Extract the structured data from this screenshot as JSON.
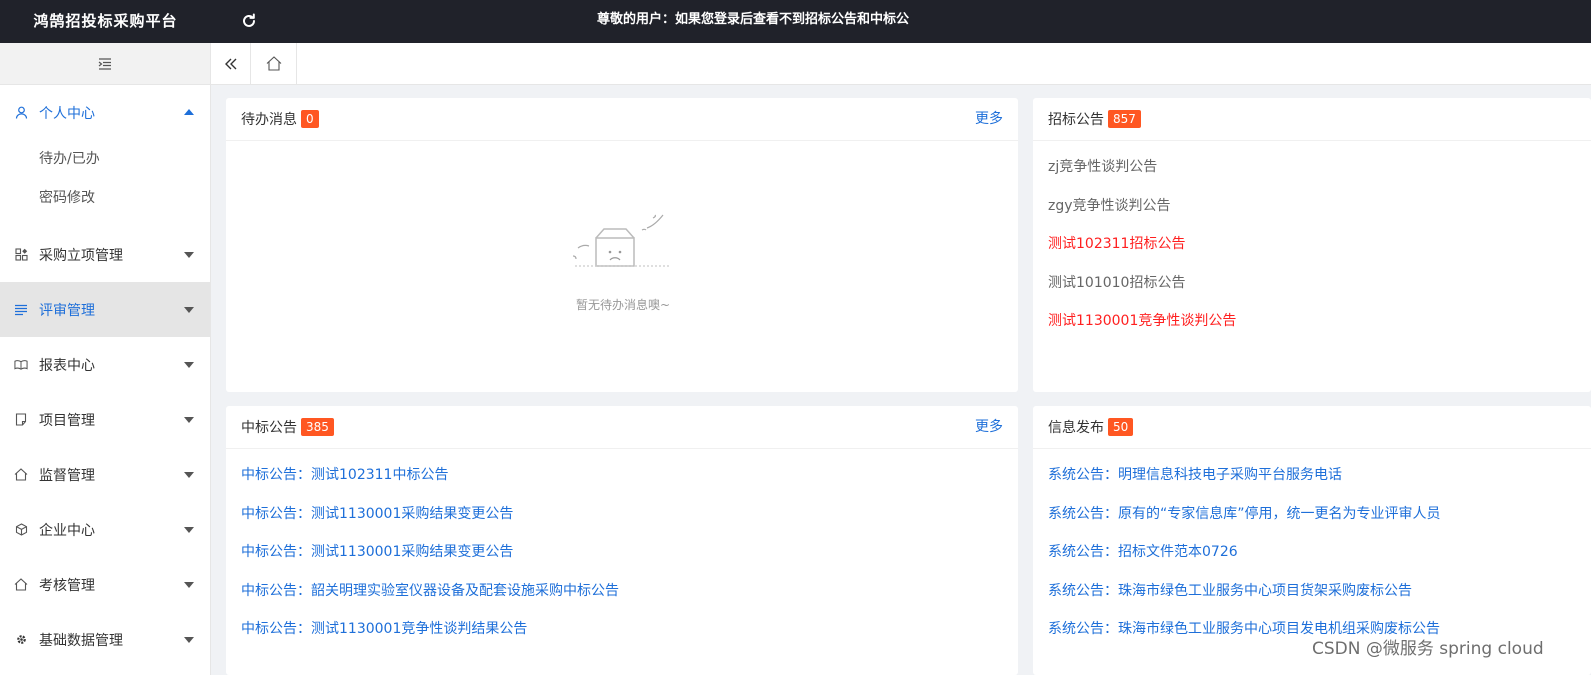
{
  "app": {
    "title": "鸿鹄招投标采购平台",
    "notice": "尊敬的用户：如果您登录后查看不到招标公告和中标公"
  },
  "sidebar": {
    "items": [
      {
        "label": "个人中心",
        "icon": "user-icon",
        "open": true,
        "sub": [
          "待办/已办",
          "密码修改"
        ]
      },
      {
        "label": "采购立项管理",
        "icon": "grid-icon"
      },
      {
        "label": "评审管理",
        "icon": "list-icon",
        "active": true
      },
      {
        "label": "报表中心",
        "icon": "book-icon"
      },
      {
        "label": "项目管理",
        "icon": "note-icon"
      },
      {
        "label": "监督管理",
        "icon": "home-icon"
      },
      {
        "label": "企业中心",
        "icon": "cube-icon"
      },
      {
        "label": "考核管理",
        "icon": "home-icon"
      },
      {
        "label": "基础数据管理",
        "icon": "gear-icon"
      }
    ]
  },
  "todo": {
    "title": "待办消息",
    "count": "0",
    "more": "更多",
    "empty_text": "暂无待办消息噢~"
  },
  "tender": {
    "title": "招标公告",
    "count": "857",
    "items": [
      {
        "text": "zj竞争性谈判公告",
        "color": "gray"
      },
      {
        "text": "zgy竞争性谈判公告",
        "color": "gray"
      },
      {
        "text": "测试102311招标公告",
        "color": "red"
      },
      {
        "text": "测试101010招标公告",
        "color": "gray"
      },
      {
        "text": "测试1130001竞争性谈判公告",
        "color": "red"
      }
    ]
  },
  "award": {
    "title": "中标公告",
    "count": "385",
    "more": "更多",
    "items": [
      "中标公告：测试102311中标公告",
      "中标公告：测试1130001采购结果变更公告",
      "中标公告：测试1130001采购结果变更公告",
      "中标公告：韶关明理实验室仪器设备及配套设施采购中标公告",
      "中标公告：测试1130001竞争性谈判结果公告"
    ]
  },
  "info": {
    "title": "信息发布",
    "count": "50",
    "items": [
      "系统公告：明理信息科技电子采购平台服务电话",
      "系统公告：原有的“专家信息库”停用，统一更名为专业评审人员",
      "系统公告：招标文件范本0726",
      "系统公告：珠海市绿色工业服务中心项目货架采购废标公告",
      "系统公告：珠海市绿色工业服务中心项目发电机组采购废标公告"
    ]
  },
  "watermark": "CSDN @微服务 spring cloud",
  "colors": {
    "topbar": "#20222a",
    "accent": "#1e6fd9",
    "badge": "#ff5722",
    "red_link": "#ff1f1f"
  }
}
